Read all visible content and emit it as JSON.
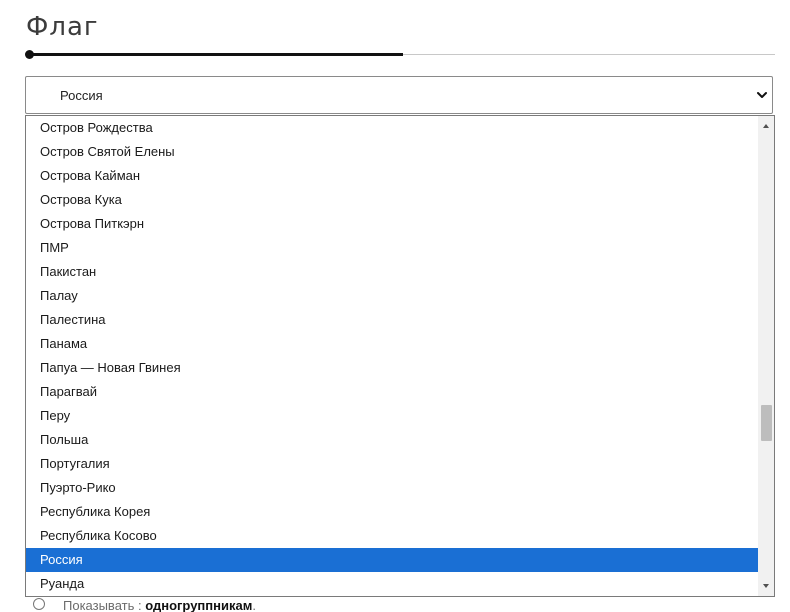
{
  "section": {
    "title": "Флаг",
    "progress": 0.5
  },
  "select": {
    "value": "Россия"
  },
  "dropdown": {
    "options": [
      "Остров Рождества",
      "Остров Святой Елены",
      "Острова Кайман",
      "Острова Кука",
      "Острова Питкэрн",
      "ПМР",
      "Пакистан",
      "Палау",
      "Палестина",
      "Панама",
      "Папуа — Новая Гвинея",
      "Парагвай",
      "Перу",
      "Польша",
      "Португалия",
      "Пуэрто-Рико",
      "Республика Корея",
      "Республика Косово",
      "Россия",
      "Руанда"
    ],
    "selected_index": 18
  },
  "bottom_option": {
    "prefix": "Показывать : ",
    "emphasis": "одногруппникам",
    "suffix": "."
  },
  "colors": {
    "selected_bg": "#1a6fd4",
    "selected_text": "#ffffff"
  }
}
